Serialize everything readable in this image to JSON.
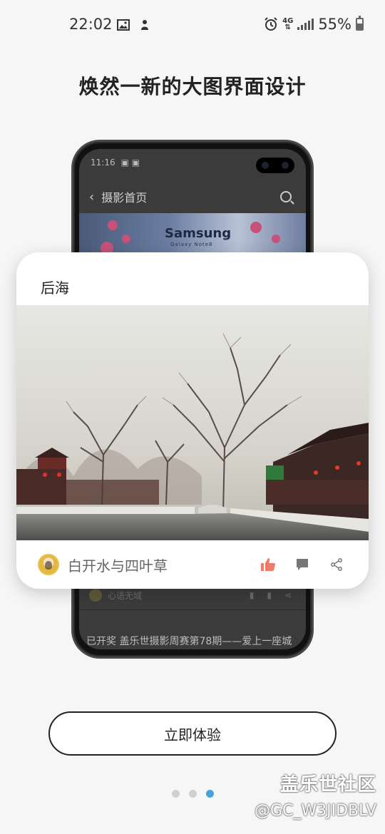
{
  "status_bar": {
    "time": "22:02",
    "network": "4G",
    "battery": "55%"
  },
  "headline": "焕然一新的大图界面设计",
  "phone_mock": {
    "time": "11:16",
    "nav_title": "摄影首页",
    "brand": "Samsung",
    "brand_sub": "Galaxy Note8",
    "user_label": "心语无域",
    "caption": "已开奖   盖乐世摄影周赛第78期——爱上一座城"
  },
  "card": {
    "title": "后海",
    "username": "白开水与四叶草",
    "like_color": "#f07a6a"
  },
  "cta_label": "立即体验",
  "pagination": {
    "count": 3,
    "active": 3
  },
  "watermark": {
    "line1": "盖乐世社区",
    "line2": "@GC_W3JIDBLV"
  }
}
